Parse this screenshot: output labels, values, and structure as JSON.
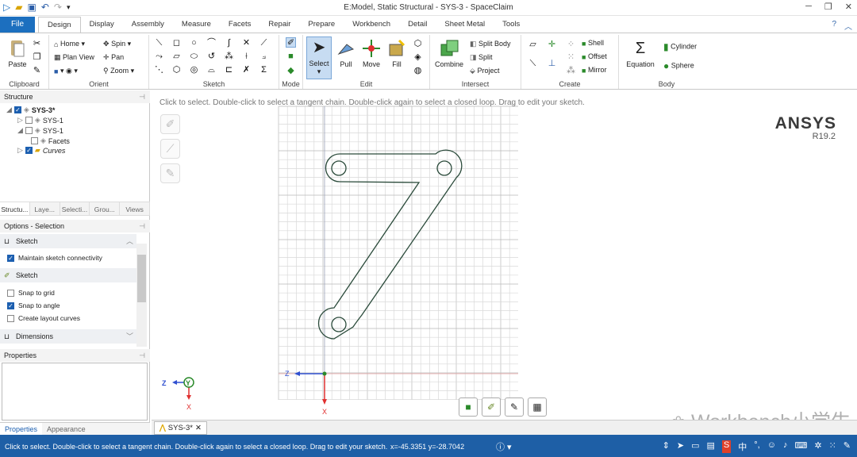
{
  "window": {
    "title": "E:Model, Static Structural - SYS-3 - SpaceClaim"
  },
  "ribbon_tabs": {
    "file": "File",
    "items": [
      "Design",
      "Display",
      "Assembly",
      "Measure",
      "Facets",
      "Repair",
      "Prepare",
      "Workbench",
      "Detail",
      "Sheet Metal",
      "Tools"
    ],
    "active": "Design"
  },
  "ribbon": {
    "clipboard": {
      "label": "Clipboard",
      "paste": "Paste"
    },
    "orient": {
      "label": "Orient",
      "home": "Home",
      "spin": "Spin",
      "plan_view": "Plan View",
      "pan": "Pan",
      "zoom": "Zoom"
    },
    "sketch": {
      "label": "Sketch"
    },
    "mode": {
      "label": "Mode"
    },
    "edit": {
      "label": "Edit",
      "select": "Select",
      "pull": "Pull",
      "move": "Move",
      "fill": "Fill"
    },
    "intersect": {
      "label": "Intersect",
      "combine": "Combine",
      "split_body": "Split Body",
      "split": "Split",
      "project": "Project"
    },
    "create": {
      "label": "Create",
      "shell": "Shell",
      "offset": "Offset",
      "mirror": "Mirror"
    },
    "body": {
      "label": "Body",
      "equation": "Equation",
      "cylinder": "Cylinder",
      "sphere": "Sphere"
    }
  },
  "structure": {
    "header": "Structure",
    "tree": [
      {
        "label": "SYS-3*",
        "level": 0,
        "checked": true
      },
      {
        "label": "SYS-1",
        "level": 1,
        "checked": false
      },
      {
        "label": "SYS-1",
        "level": 1,
        "checked": false
      },
      {
        "label": "Facets",
        "level": 2,
        "checked": false
      },
      {
        "label": "Curves",
        "level": 1,
        "checked": true
      }
    ]
  },
  "panel_tabs": [
    "Structu...",
    "Laye...",
    "Selecti...",
    "Grou...",
    "Views"
  ],
  "options": {
    "header": "Options - Selection",
    "section1": "Sketch",
    "maintain": "Maintain sketch connectivity",
    "section2": "Sketch",
    "snap_grid": "Snap to grid",
    "snap_angle": "Snap to angle",
    "layout_curves": "Create layout curves",
    "dimensions": "Dimensions"
  },
  "properties": {
    "header": "Properties",
    "tabs": [
      "Properties",
      "Appearance"
    ]
  },
  "viewport": {
    "hint": "Click to select. Double-click to select a tangent chain. Double-click again to select a closed loop. Drag to edit your sketch.",
    "brand": "ANSYS",
    "version": "R19.2",
    "axis_z": "Z",
    "axis_y": "Y",
    "axis_x": "X",
    "watermark": "Workbench小学生"
  },
  "doc_tab": "SYS-3*",
  "status": {
    "message": "Click to select. Double-click to select a tangent chain. Double-click again to select a closed loop. Drag to edit your sketch.",
    "coords": "x=-45.3351  y=-28.7042",
    "ime": "中"
  },
  "colors": {
    "accent": "#1c6fbf",
    "status_bar": "#1e5fa6",
    "grid": "#d9d9d9",
    "grid_major": "#b8b8b8",
    "axis_red": "#e03030",
    "axis_blue": "#3050d0"
  }
}
